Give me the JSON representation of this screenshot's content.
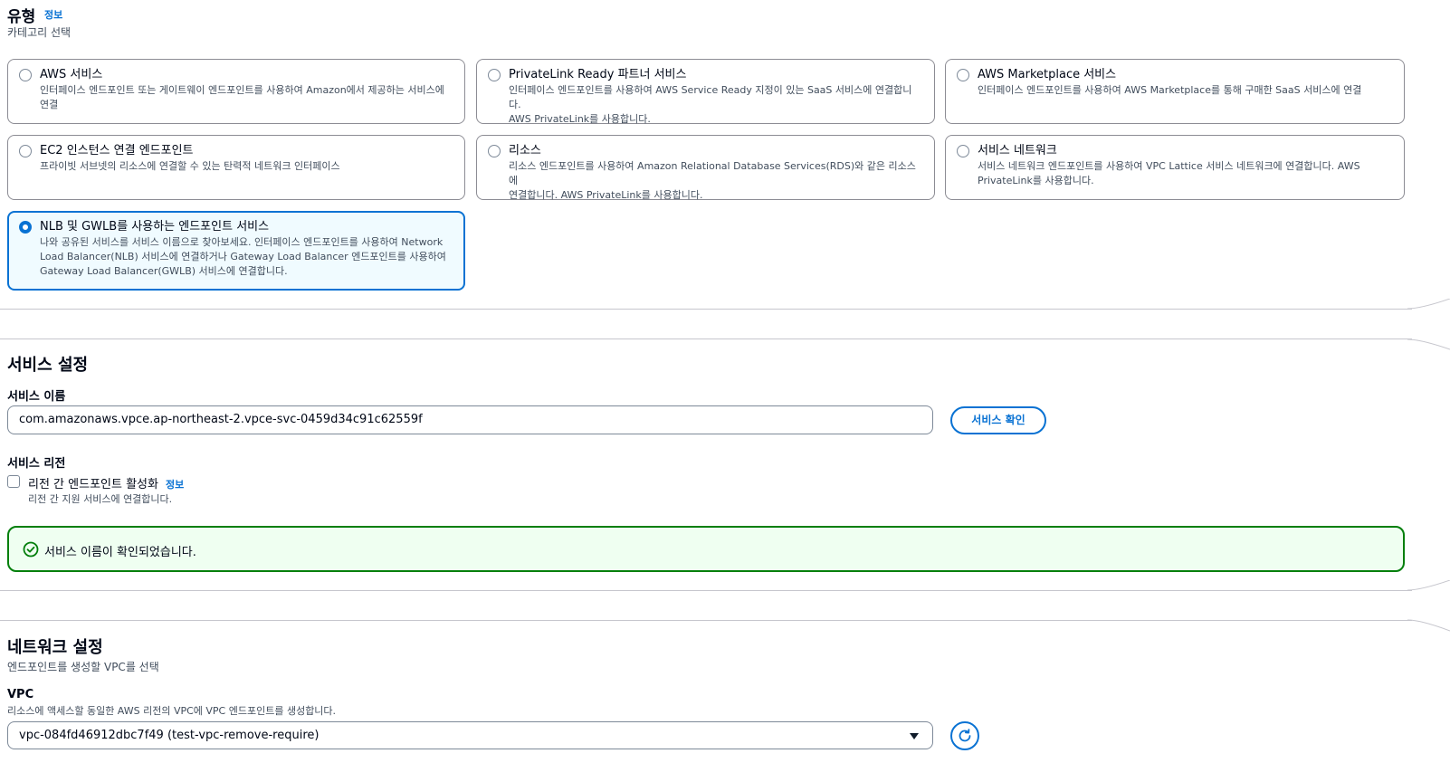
{
  "type_section": {
    "title": "유형",
    "info": "정보",
    "subtitle": "카테고리 선택",
    "options": [
      {
        "title": "AWS 서비스",
        "desc_line1": "인터페이스 엔드포인트 또는 게이트웨이 엔드포인트를 사용하여 Amazon에서 제공하는 서비스에",
        "desc_line2": "연결",
        "selected": false
      },
      {
        "title": "PrivateLink Ready 파트너 서비스",
        "desc_line1": "인터페이스 엔드포인트를 사용하여 AWS Service Ready 지정이 있는 SaaS 서비스에 연결합니다.",
        "desc_line2": "AWS PrivateLink를 사용합니다.",
        "selected": false
      },
      {
        "title": "AWS Marketplace 서비스",
        "desc_line1": "인터페이스 엔드포인트를 사용하여 AWS Marketplace를 통해 구매한 SaaS 서비스에 연결",
        "desc_line2": "",
        "selected": false
      },
      {
        "title": "EC2 인스턴스 연결 엔드포인트",
        "desc_line1": "프라이빗 서브넷의 리소스에 연결할 수 있는 탄력적 네트워크 인터페이스",
        "desc_line2": "",
        "selected": false
      },
      {
        "title": "리소스",
        "desc_line1": "리소스 엔드포인트를 사용하여 Amazon Relational Database Services(RDS)와 같은 리소스에",
        "desc_line2": "연결합니다. AWS PrivateLink를 사용합니다.",
        "selected": false
      },
      {
        "title": "서비스 네트워크",
        "desc_line1": "서비스 네트워크 엔드포인트를 사용하여 VPC Lattice 서비스 네트워크에 연결합니다. AWS",
        "desc_line2": "PrivateLink를 사용합니다.",
        "selected": false
      },
      {
        "title": "NLB 및 GWLB를 사용하는 엔드포인트 서비스",
        "desc_line1": "나와 공유된 서비스를 서비스 이름으로 찾아보세요. 인터페이스 엔드포인트를 사용하여 Network",
        "desc_line2": "Load Balancer(NLB) 서비스에 연결하거나 Gateway Load Balancer 엔드포인트를 사용하여",
        "desc_line3": "Gateway Load Balancer(GWLB) 서비스에 연결합니다.",
        "selected": true
      }
    ]
  },
  "service_settings": {
    "title": "서비스 설정",
    "name_label": "서비스 이름",
    "name_value": "com.amazonaws.vpce.ap-northeast-2.vpce-svc-0459d34c91c62559f",
    "verify_button": "서비스 확인",
    "region_label": "서비스 리전",
    "cross_region_label": "리전 간 엔드포인트 활성화",
    "cross_region_info": "정보",
    "cross_region_desc": "리전 간 지원 서비스에 연결합니다.",
    "cross_region_checked": false,
    "alert_text": "서비스 이름이 확인되었습니다."
  },
  "network_settings": {
    "title": "네트워크 설정",
    "subtitle": "엔드포인트를 생성할 VPC를 선택",
    "vpc_label": "VPC",
    "vpc_desc": "리소스에 액세스할 동일한 AWS 리전의 VPC에 VPC 엔드포인트를 생성합니다.",
    "vpc_value": "vpc-084fd46912dbc7f49 (test-vpc-remove-require)"
  },
  "colors": {
    "accent": "#0972d3",
    "success": "#037f0c",
    "success_bg": "#effff1",
    "selected_bg": "#f0fbff"
  }
}
